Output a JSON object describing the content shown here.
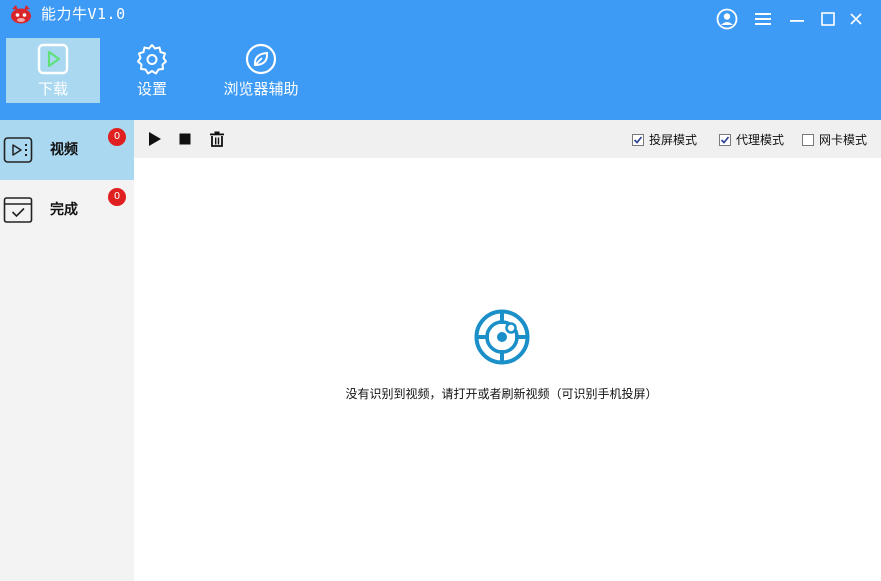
{
  "window": {
    "title": "能力牛V1.0",
    "controls": [
      "user-icon",
      "menu-icon",
      "minimize-icon",
      "maximize-icon",
      "close-icon"
    ]
  },
  "main_tabs": [
    {
      "label": "下载",
      "icon": "play-square-icon",
      "active": true
    },
    {
      "label": "设置",
      "icon": "gear-icon",
      "active": false
    },
    {
      "label": "浏览器辅助",
      "icon": "browser-leaf-icon",
      "active": false
    }
  ],
  "sidebar": {
    "items": [
      {
        "label": "视频",
        "icon": "video-icon",
        "badge": "0",
        "active": true
      },
      {
        "label": "完成",
        "icon": "done-icon",
        "badge": "0",
        "active": false
      }
    ]
  },
  "toolbar": {
    "buttons": [
      "play-icon",
      "stop-icon",
      "trash-icon"
    ],
    "options": [
      {
        "label": "投屏模式",
        "checked": true
      },
      {
        "label": "代理模式",
        "checked": true
      },
      {
        "label": "网卡模式",
        "checked": false
      }
    ]
  },
  "content": {
    "empty_message": "没有识别到视频，请打开或者刷新视频（可识别手机投屏）",
    "icon": "radar-icon"
  },
  "colors": {
    "header": "#3d9af5",
    "active_bg": "#a9d8f0",
    "badge": "#e02020",
    "radar": "#1a8fc8"
  }
}
